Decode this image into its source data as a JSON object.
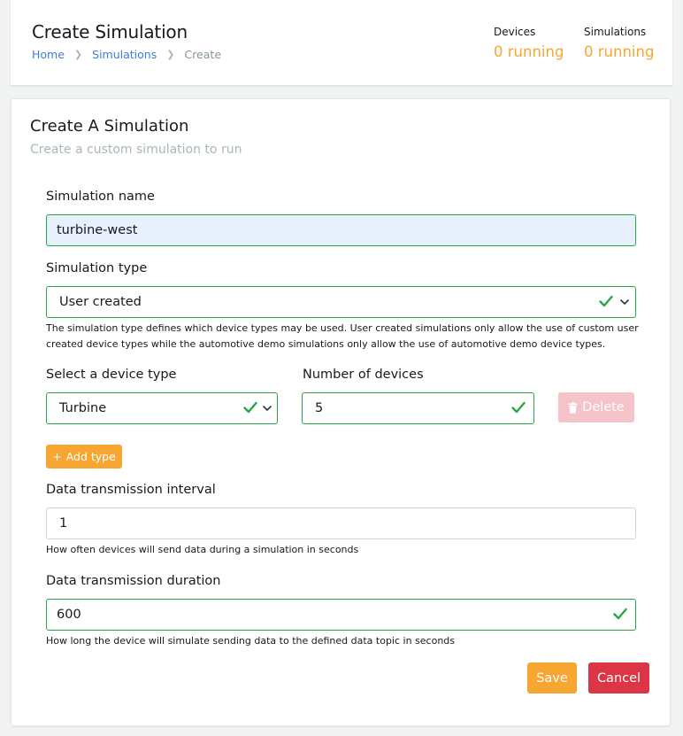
{
  "header": {
    "title": "Create Simulation",
    "breadcrumb": [
      "Home",
      "Simulations",
      "Create"
    ],
    "stats": [
      {
        "label": "Devices",
        "value": "0 running"
      },
      {
        "label": "Simulations",
        "value": "0 running"
      }
    ]
  },
  "form": {
    "title": "Create A Simulation",
    "subtitle": "Create a custom simulation to run",
    "simulation_name": {
      "label": "Simulation name",
      "value": "turbine-west"
    },
    "simulation_type": {
      "label": "Simulation type",
      "value": "User created",
      "help": "The simulation type defines which device types may be used. User created simulations only allow the use of custom user created device types while the automotive demo simulations only allow the use of automotive demo device types."
    },
    "device_type": {
      "label": "Select a device type",
      "value": "Turbine"
    },
    "num_devices": {
      "label": "Number of devices",
      "value": "5"
    },
    "delete_label": "Delete",
    "add_type_label": "Add type",
    "interval": {
      "label": "Data transmission interval",
      "value": "1",
      "help": "How often devices will send data during a simulation in seconds"
    },
    "duration": {
      "label": "Data transmission duration",
      "value": "600",
      "help": "How long the device will simulate sending data to the defined data topic in seconds"
    },
    "save_label": "Save",
    "cancel_label": "Cancel"
  },
  "colors": {
    "accent": "#f8a632",
    "link": "#3b7ddd",
    "valid": "#28a745",
    "danger": "#dc3545",
    "danger_disabled": "#f5c3c8",
    "autofill_bg": "#e8f0fe"
  }
}
